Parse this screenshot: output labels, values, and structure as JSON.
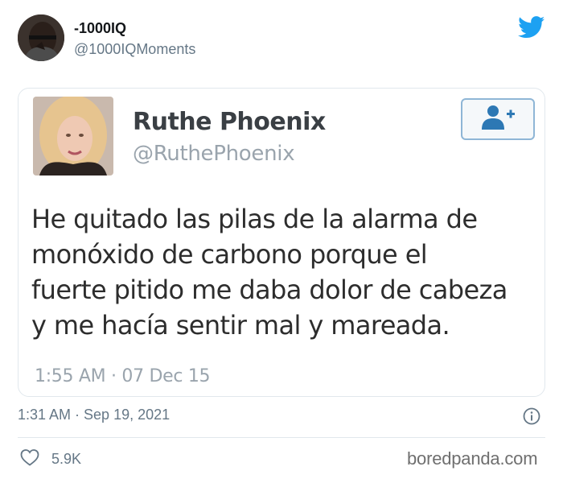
{
  "author": {
    "name": "-1000IQ",
    "handle": "@1000IQMoments"
  },
  "embedded_tweet": {
    "name": "Ruthe Phoenix",
    "handle": "@RuthePhoenix",
    "text": "He quitado las pilas de la alarma de\nmonóxido de carbono porque el\nfuerte pitido me daba dolor de cabeza\ny me hacía sentir mal y mareada.",
    "timestamp": "1:55 AM · 07 Dec 15"
  },
  "post": {
    "timestamp": "1:31 AM · Sep 19, 2021",
    "likes": "5.9K"
  },
  "watermark": "boredpanda.com",
  "colors": {
    "twitter_blue": "#1da1f2",
    "follow_icon": "#2d78b4",
    "secondary_text": "#657786"
  },
  "icons": [
    "twitter-bird-icon",
    "add-user-icon",
    "info-icon",
    "heart-icon"
  ]
}
